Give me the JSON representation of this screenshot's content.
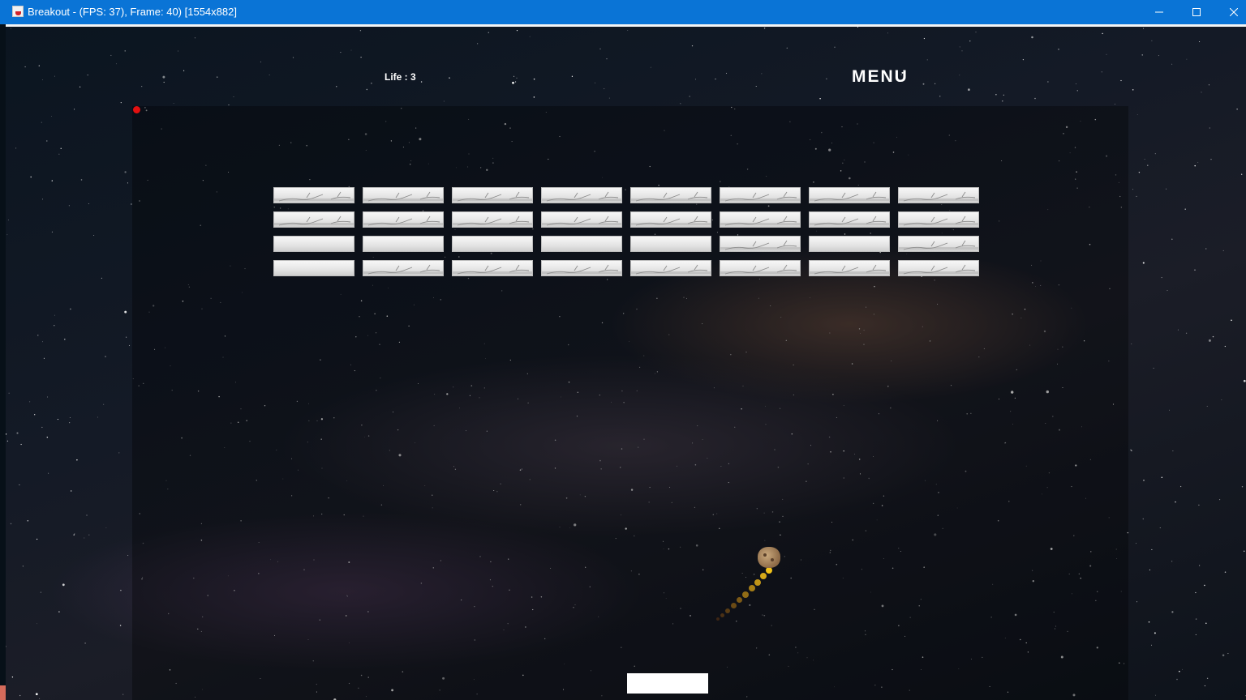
{
  "window": {
    "title": "Breakout - (FPS: 37), Frame: 40) [1554x882]",
    "icon": "java-cup-icon",
    "controls": [
      "minimize-icon",
      "maximize-icon",
      "close-icon"
    ]
  },
  "hud": {
    "life_label": "Life : 3",
    "menu_label": "MENU"
  },
  "bricks": {
    "rows": 4,
    "columns": 8,
    "layout": [
      [
        "cracked",
        "cracked",
        "cracked",
        "cracked",
        "cracked",
        "cracked",
        "cracked",
        "cracked"
      ],
      [
        "cracked",
        "cracked",
        "cracked",
        "cracked",
        "cracked",
        "cracked",
        "cracked",
        "cracked"
      ],
      [
        "plain",
        "plain",
        "plain",
        "plain",
        "plain",
        "cracked",
        "plain",
        "cracked"
      ],
      [
        "plain",
        "cracked",
        "cracked",
        "cracked",
        "cracked",
        "cracked",
        "cracked",
        "cracked"
      ]
    ]
  },
  "colors": {
    "titlebar": "#0a74d6",
    "paddle": "#ffffff",
    "corner_dot": "#e31010",
    "trail_start": "#f2c21a",
    "trail_end": "#6b3a12"
  }
}
